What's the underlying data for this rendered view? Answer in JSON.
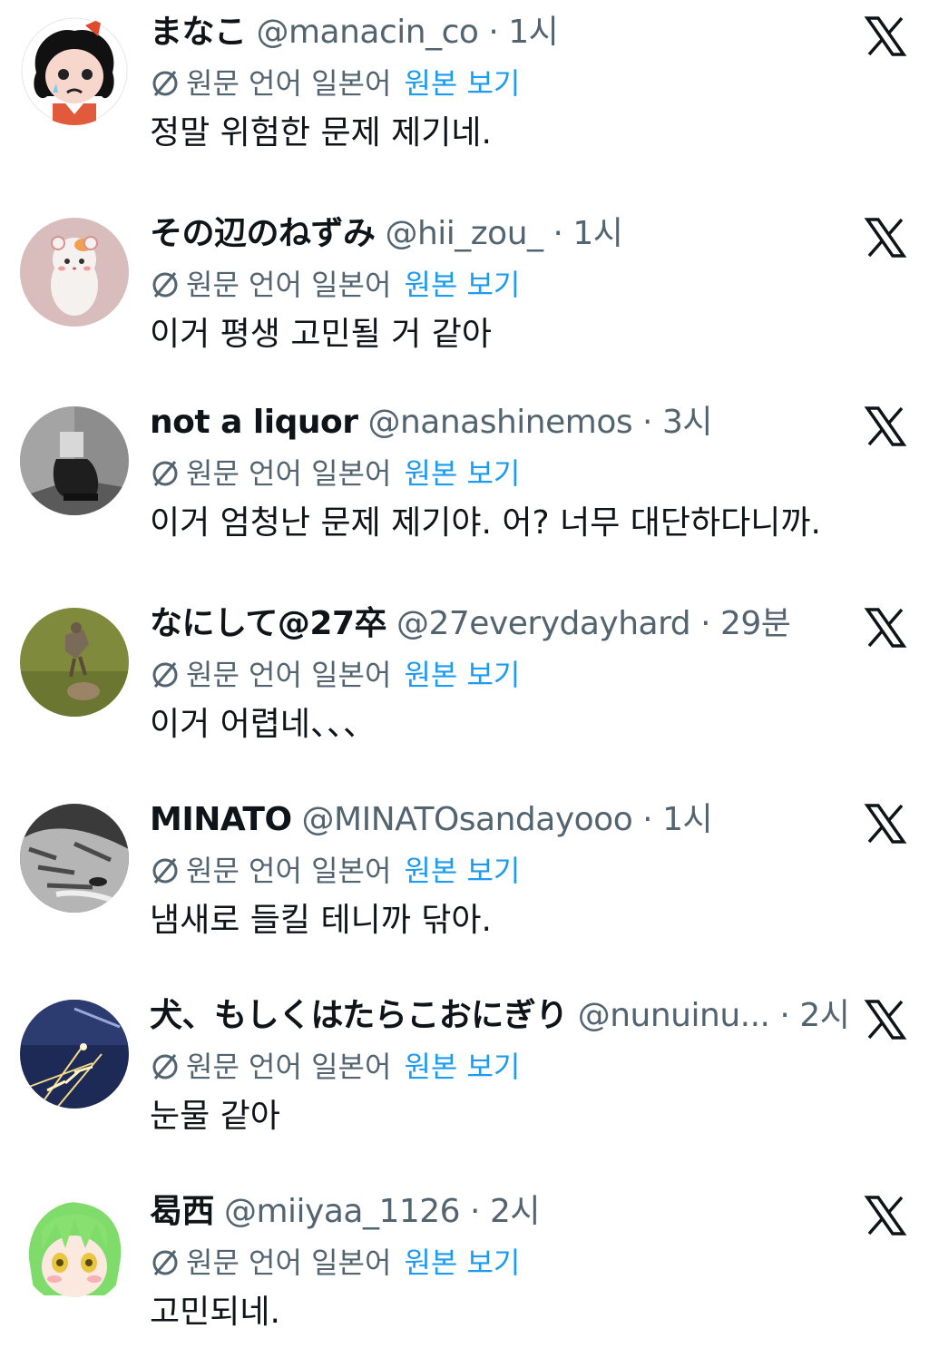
{
  "translation": {
    "label": "원문 언어 일본어",
    "view_original": "원본 보기",
    "icon": "no-translate-icon"
  },
  "posts": [
    {
      "name": "まなこ",
      "handle": "@manacin_co",
      "time": "1시",
      "text": "정말 위험한 문제 제기네.",
      "avatar_icon": "cartoon-girl-avatar"
    },
    {
      "name": "その辺のねずみ",
      "handle": "@hii_zou_",
      "time": "1시",
      "text": "이거 평생 고민될 거 같아",
      "avatar_icon": "hamster-avatar"
    },
    {
      "name": "not a liquor",
      "handle": "@nanashinemos",
      "time": "3시",
      "text": "이거 엄청난 문제 제기야. 어? 너무 대단하다니까.",
      "avatar_icon": "box-head-person-avatar"
    },
    {
      "name": "なにして@27卒",
      "handle": "@27everydayhard",
      "time": "29분",
      "text": "이거 어렵네、、、",
      "avatar_icon": "animals-on-grass-avatar"
    },
    {
      "name": "MINATO",
      "handle": "@MINATOsandayooo",
      "time": "1시",
      "text": "냄새로 들킬 테니까 닦아.",
      "avatar_icon": "cat-sleeping-avatar"
    },
    {
      "name": "犬、もしくはたらこおにぎり",
      "handle": "@nunuinu...",
      "time": "2시",
      "text": "눈물 같아",
      "avatar_icon": "sparkler-night-avatar"
    },
    {
      "name": "曷西",
      "handle": "@miiyaa_1126",
      "time": "2시",
      "text": "고민되네.",
      "avatar_icon": "green-hair-anime-avatar"
    }
  ],
  "close_icon": "x-close-icon",
  "colors": {
    "text": "#0f1419",
    "secondary": "#536471",
    "link": "#1d9bf0"
  }
}
